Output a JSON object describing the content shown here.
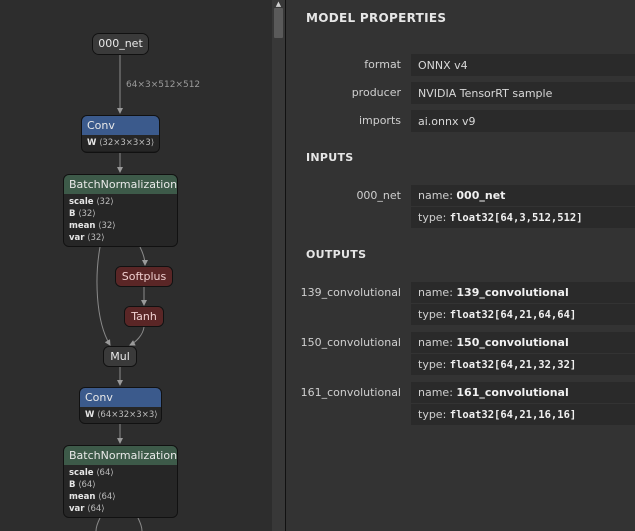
{
  "graph": {
    "nodes": {
      "input": {
        "label": "000_net"
      },
      "conv1": {
        "label": "Conv",
        "attrs": [
          {
            "key": "W",
            "value": "⟨32×3×3×3⟩"
          }
        ]
      },
      "bn1": {
        "label": "BatchNormalization",
        "attrs": [
          {
            "key": "scale",
            "value": "⟨32⟩"
          },
          {
            "key": "B",
            "value": "⟨32⟩"
          },
          {
            "key": "mean",
            "value": "⟨32⟩"
          },
          {
            "key": "var",
            "value": "⟨32⟩"
          }
        ]
      },
      "softplus": {
        "label": "Softplus"
      },
      "tanh": {
        "label": "Tanh"
      },
      "mul": {
        "label": "Mul"
      },
      "conv2": {
        "label": "Conv",
        "attrs": [
          {
            "key": "W",
            "value": "⟨64×32×3×3⟩"
          }
        ]
      },
      "bn2": {
        "label": "BatchNormalization",
        "attrs": [
          {
            "key": "scale",
            "value": "⟨64⟩"
          },
          {
            "key": "B",
            "value": "⟨64⟩"
          },
          {
            "key": "mean",
            "value": "⟨64⟩"
          },
          {
            "key": "var",
            "value": "⟨64⟩"
          }
        ]
      }
    },
    "edge_label": "64×3×512×512"
  },
  "panel": {
    "title": "MODEL PROPERTIES",
    "properties": [
      {
        "label": "format",
        "value": "ONNX v4"
      },
      {
        "label": "producer",
        "value": "NVIDIA TensorRT sample"
      },
      {
        "label": "imports",
        "value": "ai.onnx v9"
      }
    ],
    "inputs_title": "INPUTS",
    "inputs": [
      {
        "label": "000_net",
        "name_key": "name:",
        "name": "000_net",
        "type_key": "type:",
        "type": "float32[64,3,512,512]"
      }
    ],
    "outputs_title": "OUTPUTS",
    "outputs": [
      {
        "label": "139_convolutional",
        "name_key": "name:",
        "name": "139_convolutional",
        "type_key": "type:",
        "type": "float32[64,21,64,64]"
      },
      {
        "label": "150_convolutional",
        "name_key": "name:",
        "name": "150_convolutional",
        "type_key": "type:",
        "type": "float32[64,21,32,32]"
      },
      {
        "label": "161_convolutional",
        "name_key": "name:",
        "name": "161_convolutional",
        "type_key": "type:",
        "type": "float32[64,21,16,16]"
      }
    ]
  },
  "scrollbar": {
    "up_arrow": "▲"
  },
  "colors": {
    "conv": "#3b5a8c",
    "batchnorm": "#3d5a49",
    "activation": "#5a2626",
    "panel_bg": "#333333"
  }
}
